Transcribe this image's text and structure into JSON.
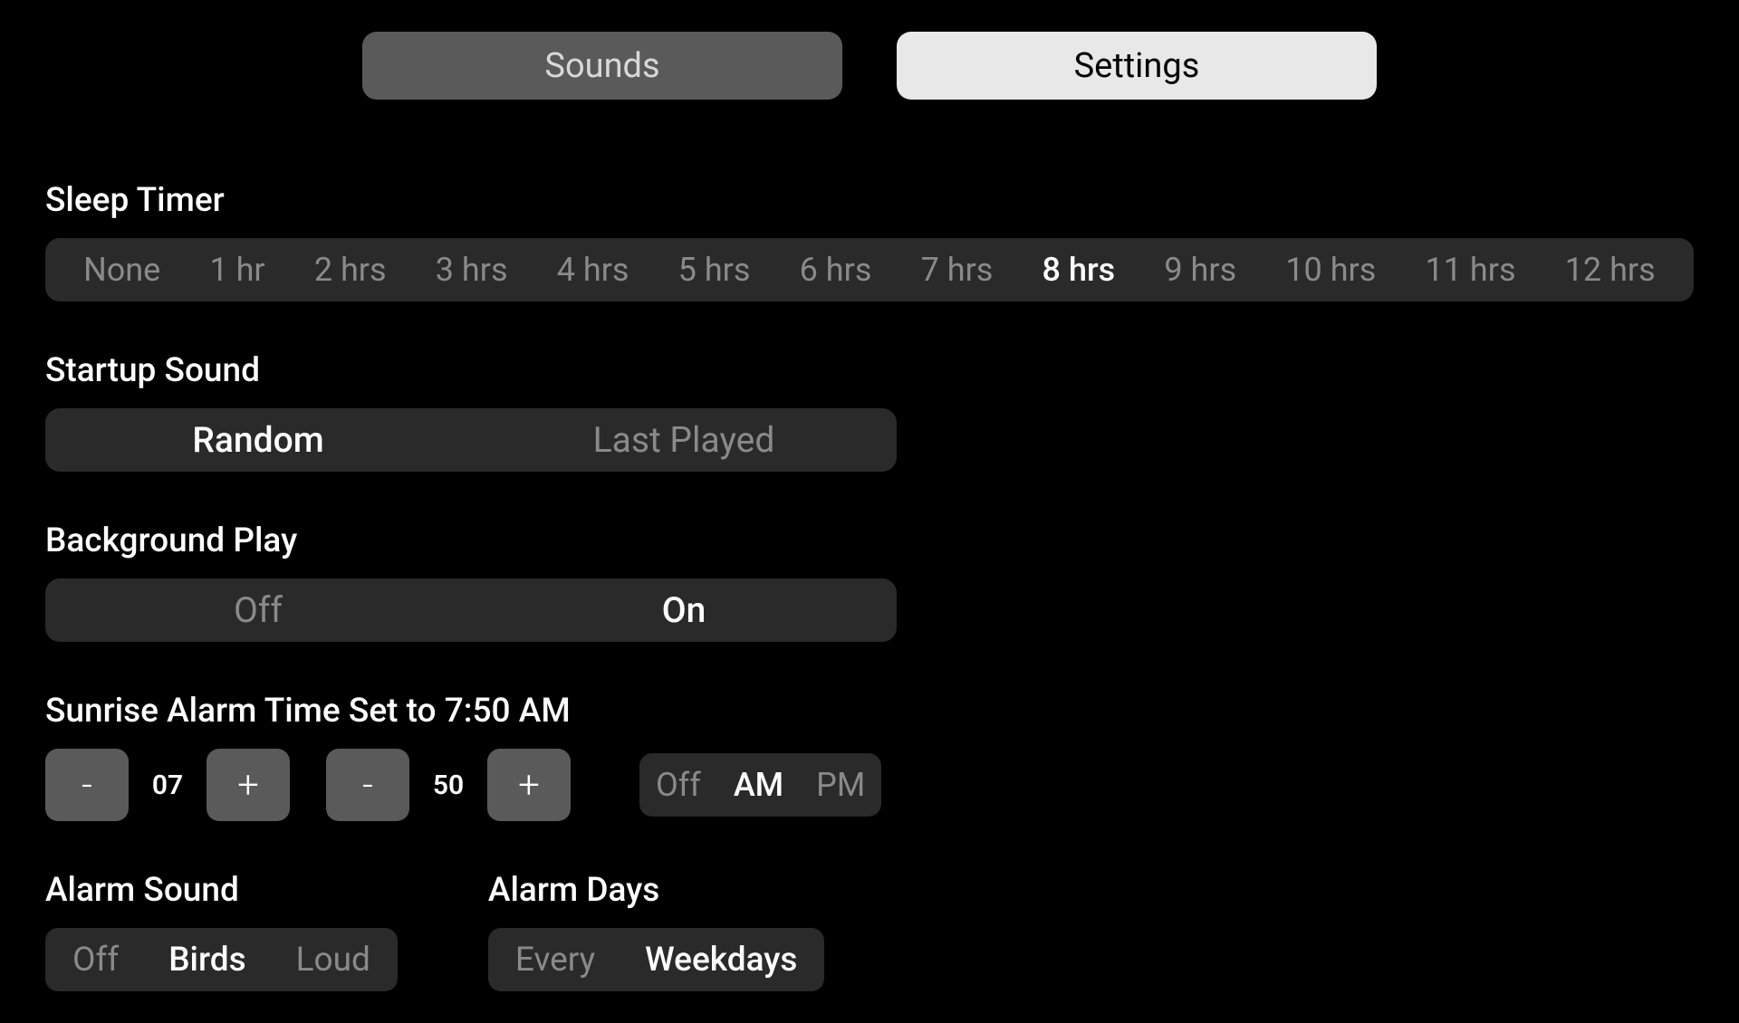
{
  "tabs": {
    "sounds": "Sounds",
    "settings": "Settings",
    "active": "settings"
  },
  "sleep_timer": {
    "label": "Sleep Timer",
    "options": [
      "None",
      "1 hr",
      "2 hrs",
      "3 hrs",
      "4 hrs",
      "5 hrs",
      "6 hrs",
      "7 hrs",
      "8 hrs",
      "9 hrs",
      "10 hrs",
      "11 hrs",
      "12 hrs"
    ],
    "selected_index": 8
  },
  "startup_sound": {
    "label": "Startup Sound",
    "options": [
      "Random",
      "Last Played"
    ],
    "selected_index": 0
  },
  "background_play": {
    "label": "Background Play",
    "options": [
      "Off",
      "On"
    ],
    "selected_index": 1
  },
  "sunrise_alarm": {
    "label": "Sunrise Alarm Time Set to 7:50 AM",
    "hour": "07",
    "minute": "50",
    "minus": "-",
    "plus": "+",
    "period_options": [
      "Off",
      "AM",
      "PM"
    ],
    "period_selected_index": 1
  },
  "alarm_sound": {
    "label": "Alarm Sound",
    "options": [
      "Off",
      "Birds",
      "Loud"
    ],
    "selected_index": 1
  },
  "alarm_days": {
    "label": "Alarm Days",
    "options": [
      "Every",
      "Weekdays"
    ],
    "selected_index": 1
  }
}
